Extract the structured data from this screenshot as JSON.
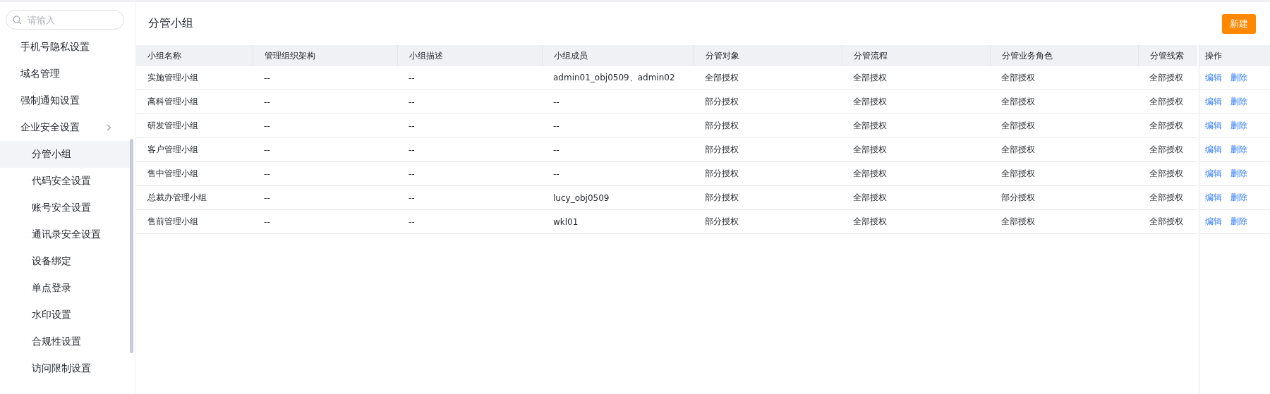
{
  "sidebar": {
    "search": {
      "placeholder": "请输入"
    },
    "items": [
      {
        "label": "手机号隐私设置",
        "selected": false
      },
      {
        "label": "域名管理",
        "selected": false
      },
      {
        "label": "强制通知设置",
        "selected": false
      },
      {
        "label": "企业安全设置",
        "selected": false,
        "expanded": true,
        "children": [
          {
            "label": "分管小组",
            "selected": true
          },
          {
            "label": "代码安全设置",
            "selected": false
          },
          {
            "label": "账号安全设置",
            "selected": false
          },
          {
            "label": "通讯录安全设置",
            "selected": false
          },
          {
            "label": "设备绑定",
            "selected": false
          },
          {
            "label": "单点登录",
            "selected": false
          },
          {
            "label": "水印设置",
            "selected": false
          },
          {
            "label": "合规性设置",
            "selected": false
          },
          {
            "label": "访问限制设置",
            "selected": false
          }
        ]
      }
    ]
  },
  "page": {
    "title": "分管小组",
    "new_button": "新建"
  },
  "table": {
    "columns": [
      "小组名称",
      "管理组织架构",
      "小组描述",
      "小组成员",
      "分管对象",
      "分管流程",
      "分管业务角色",
      "分管线索"
    ],
    "action_column": "操作",
    "rows": [
      {
        "cells": [
          "实施管理小组",
          "--",
          "--",
          "admin01_obj0509、admin02",
          "全部授权",
          "全部授权",
          "全部授权",
          "全部授权"
        ],
        "actions": [
          "编辑",
          "删除"
        ]
      },
      {
        "cells": [
          "高科管理小组",
          "--",
          "--",
          "--",
          "部分授权",
          "全部授权",
          "全部授权",
          "全部授权"
        ],
        "actions": [
          "编辑",
          "删除"
        ]
      },
      {
        "cells": [
          "研发管理小组",
          "--",
          "--",
          "--",
          "部分授权",
          "全部授权",
          "全部授权",
          "全部授权"
        ],
        "actions": [
          "编辑",
          "删除"
        ]
      },
      {
        "cells": [
          "客户管理小组",
          "--",
          "--",
          "--",
          "部分授权",
          "全部授权",
          "全部授权",
          "全部授权"
        ],
        "actions": [
          "编辑",
          "删除"
        ]
      },
      {
        "cells": [
          "售中管理小组",
          "--",
          "--",
          "--",
          "部分授权",
          "全部授权",
          "全部授权",
          "全部授权"
        ],
        "actions": [
          "编辑",
          "删除"
        ]
      },
      {
        "cells": [
          "总裁办管理小组",
          "--",
          "--",
          "lucy_obj0509",
          "部分授权",
          "全部授权",
          "部分授权",
          "全部授权"
        ],
        "actions": [
          "编辑",
          "删除"
        ]
      },
      {
        "cells": [
          "售前管理小组",
          "--",
          "--",
          "wkl01",
          "部分授权",
          "全部授权",
          "全部授权",
          "全部授权"
        ],
        "actions": [
          "编辑",
          "删除"
        ]
      }
    ]
  }
}
